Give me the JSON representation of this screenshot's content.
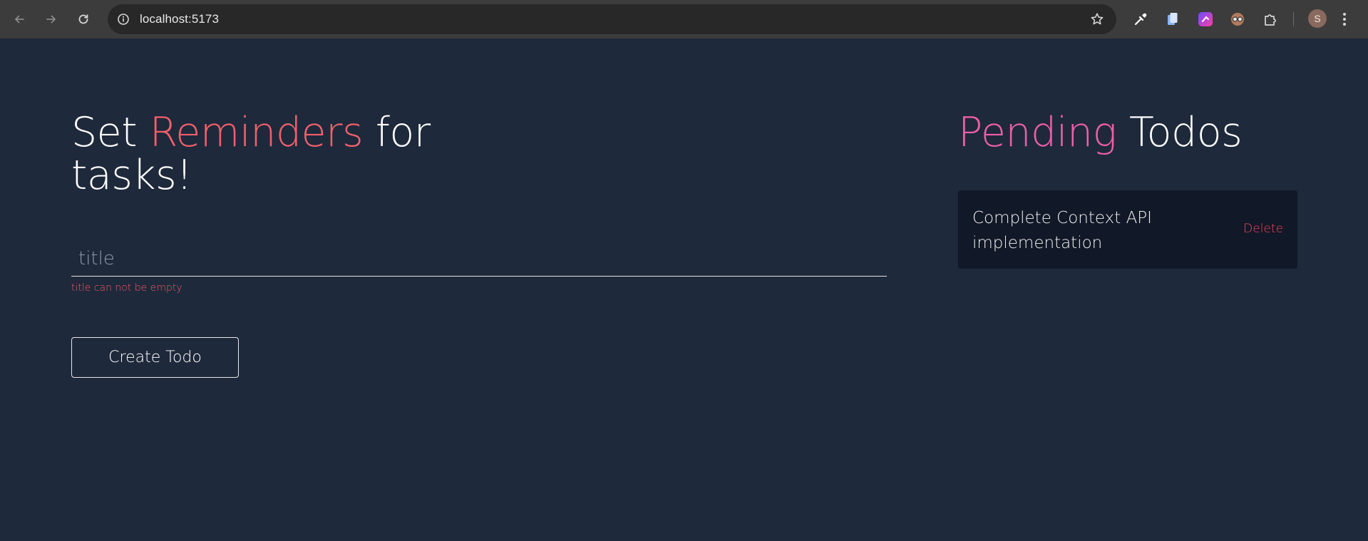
{
  "browser": {
    "url": "localhost:5173",
    "profile_initial": "S",
    "icons": [
      "back-icon",
      "forward-icon",
      "reload-icon",
      "info-icon",
      "star-icon",
      "eyedropper-icon",
      "clipboard-extension-icon",
      "gradient-extension-icon",
      "glasses-extension-icon",
      "puzzle-extension-icon",
      "kebab-menu-icon"
    ]
  },
  "form": {
    "heading_part1": "Set ",
    "heading_highlight": "Reminders",
    "heading_part2": " for tasks!",
    "title_placeholder": "title",
    "title_value": "",
    "error_message": "title can not be empty",
    "create_label": "Create Todo"
  },
  "todos": {
    "heading_highlight": "Pending",
    "heading_rest": " Todos",
    "items": [
      {
        "title": "Complete Context API implementation",
        "delete_label": "Delete"
      }
    ]
  },
  "colors": {
    "page_bg": "#1e293b",
    "card_bg": "#111827",
    "accent_red": "#f0606b",
    "accent_pink": "#ec5fa9",
    "error_red": "#ef5a63"
  }
}
